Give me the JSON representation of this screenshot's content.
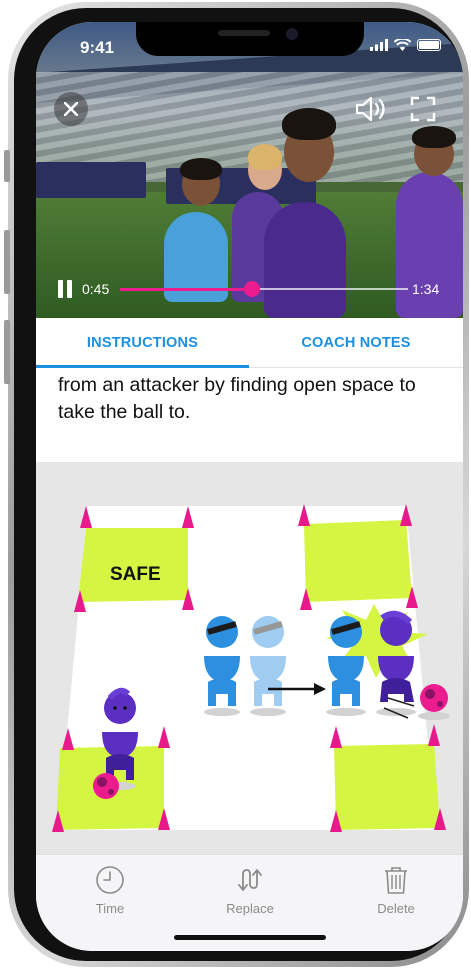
{
  "status_bar": {
    "time": "9:41"
  },
  "video": {
    "current_time": "0:45",
    "total_time": "1:34",
    "progress": 0.46,
    "state": "playing"
  },
  "tabs": [
    {
      "label": "INSTRUCTIONS",
      "active": true
    },
    {
      "label": "COACH NOTES",
      "active": false
    }
  ],
  "description": "from an attacker by finding open space to take the ball to.",
  "illustration": {
    "zone_label": "SAFE"
  },
  "toolbar": {
    "items": [
      {
        "label": "Time",
        "icon": "clock-icon"
      },
      {
        "label": "Replace",
        "icon": "swap-arrows-icon"
      },
      {
        "label": "Delete",
        "icon": "trash-icon"
      }
    ]
  },
  "colors": {
    "accent": "#1b90e0",
    "progress": "#ec1b8e",
    "zone": "#d4f542",
    "cone": "#e8198b",
    "player_blue": "#2d8fe0",
    "player_purple": "#5a2fc2"
  }
}
